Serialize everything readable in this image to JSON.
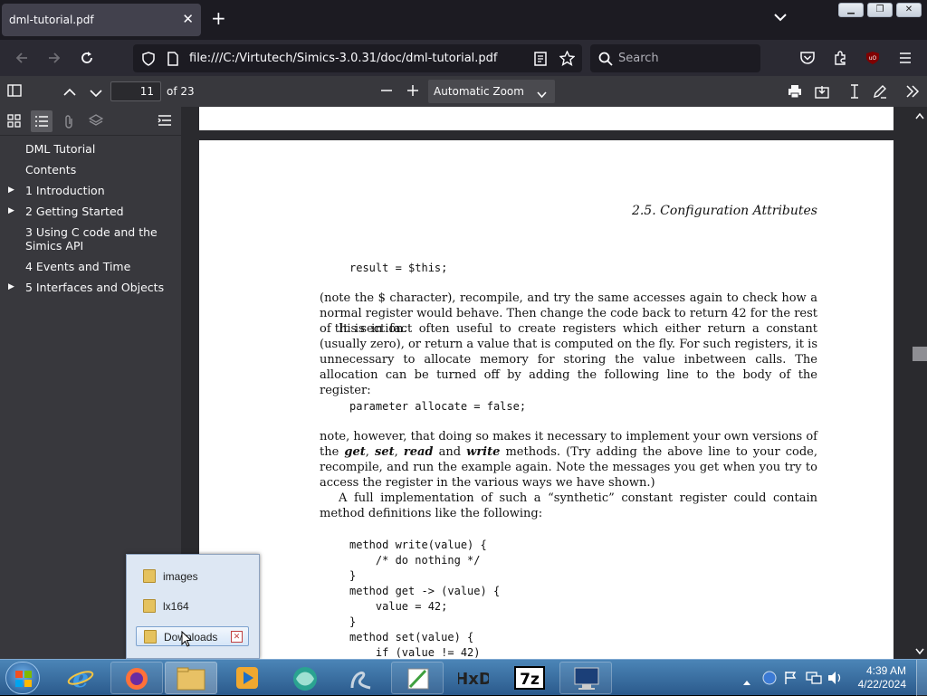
{
  "browser": {
    "tab_title": "dml-tutorial.pdf",
    "url": "file:///C:/Virtutech/Simics-3.0.31/doc/dml-tutorial.pdf",
    "search_placeholder": "Search"
  },
  "pdf_toolbar": {
    "page_number": "11",
    "page_count": "of 23",
    "zoom": "Automatic Zoom"
  },
  "outline": {
    "items": [
      {
        "label": "DML Tutorial",
        "expandable": false
      },
      {
        "label": "Contents",
        "expandable": false
      },
      {
        "label": "1 Introduction",
        "expandable": true
      },
      {
        "label": "2 Getting Started",
        "expandable": true
      },
      {
        "label": "3 Using C code and the Simics API",
        "expandable": false
      },
      {
        "label": "4 Events and Time",
        "expandable": false
      },
      {
        "label": "5 Interfaces and Objects",
        "expandable": true
      }
    ]
  },
  "document": {
    "section_header": "2.5.  Configuration Attributes",
    "code1": "result = $this;",
    "para1": "(note the $ character), recompile, and try the same accesses again to check how a normal register would behave. Then change the code back to return 42 for the rest of this section.",
    "para2": "It is in fact often useful to create registers which either return a constant (usually zero), or return a value that is computed on the fly. For such registers, it is unnecessary to allocate memory for storing the value inbetween calls. The allocation can be turned off by adding the following line to the body of the register:",
    "code2": "parameter allocate = false;",
    "para3_a": "note, however, that doing so makes it necessary to implement your own versions of the ",
    "para3_get": "get",
    "para3_set": "set",
    "para3_read": "read",
    "para3_and": " and ",
    "para3_write": "write",
    "para3_b": " methods. (Try adding the above line to your code, recompile, and run the example again. Note the messages you get when you try to access the register in the various ways we have shown.)",
    "para4": "A full implementation of such a “synthetic” constant register could contain method definitions like the following:",
    "code3": [
      "method write(value) {",
      "    /* do nothing */",
      "}",
      "method get -> (value) {",
      "    value = 42;",
      "}",
      "method set(value) {",
      "    if (value != 42)"
    ]
  },
  "jumplist": {
    "items": [
      "images",
      "lx164",
      "Downloads"
    ]
  },
  "taskbar": {
    "time": "4:39 AM",
    "date": "4/22/2024"
  }
}
